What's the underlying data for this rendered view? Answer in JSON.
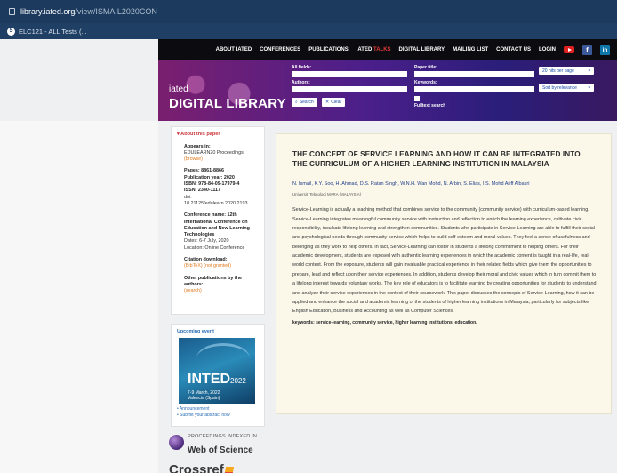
{
  "browser": {
    "url_host": "library.iated.org",
    "url_path": "/view/ISMAIL2020CON",
    "bookmark": "ELC121 - ALL Tests (..."
  },
  "topnav": {
    "items": [
      "ABOUT IATED",
      "CONFERENCES",
      "PUBLICATIONS",
      "IATED",
      "TALKS",
      "DIGITAL LIBRARY",
      "MAILING LIST",
      "CONTACT US",
      "LOGIN"
    ]
  },
  "hero": {
    "brand_small": "iated",
    "brand_big": "DIGITAL LIBRARY",
    "all_fields_label": "All fields:",
    "paper_title_label": "Paper title:",
    "authors_label": "Authors:",
    "keywords_label": "Keywords:",
    "per_page": "20 hits per page",
    "sort": "Sort by relevance",
    "search_button": "Search",
    "clear_button": "Clear",
    "fulltext_label": "Fulltext search"
  },
  "sidebar": {
    "about_header": "About this paper",
    "appears_in_label": "Appears in:",
    "appears_in_value": "EDULEARN20 Proceedings",
    "appears_in_link": "(browse)",
    "pages": "Pages: 8861-8866",
    "pub_year": "Publication year: 2020",
    "isbn": "ISBN: 978-84-09-17979-4",
    "issn": "ISSN: 2340-1117",
    "doi_label": "doi:",
    "doi_value": "10.21125/edulearn.2020.2193",
    "conf_name": "Conference name: 12th International Conference on Education and New Learning Technologies",
    "conf_dates": "Dates: 6-7 July, 2020",
    "conf_location": "Location: Online Conference",
    "citation_label": "Citation download:",
    "citation_link": "(BibTeX) (not granted)",
    "other_pubs_label": "Other publications by the authors:",
    "other_pubs_link": "(search)",
    "upcoming_header": "Upcoming event",
    "event_title": "INTED",
    "event_year": "2022",
    "event_dates": "7-9 March, 2022",
    "event_place": "Valencia (Spain)",
    "link_announcement": "• Announcement",
    "link_submit": "• Submit your abstract now",
    "wos_small": "PROCEEDINGS INDEXED IN",
    "wos_big": "Web of Science",
    "crossref": "Crossref"
  },
  "paper": {
    "title": "THE CONCEPT OF SERVICE LEARNING AND HOW IT CAN BE INTEGRATED INTO THE CURRICULUM OF A HIGHER LEARNING INSTITUTION IN MALAYSIA",
    "authors": "N. Ismail, K.Y. Soo, H. Ahmad, D.S. Ratan Singh, W.N.H. Wan Mohd, N. Arbin, S. Elias, I.S. Mohd Ariff Albakri",
    "affiliation": "Universiti Teknologi MARA (MALAYSIA)",
    "abstract": "Service-Learning is actually a teaching method that combines service to the community (community service) with curriculum-based learning. Service-Learning integrates meaningful community service with instruction and reflection to enrich the learning experience, cultivate civic responsibility, inculcate lifelong learning and strengthen communities. Students who participate in Service-Learning are able to fulfill their social and psychological needs through community service which helps to build self-esteem and moral values. They feel a sense of usefulness and belonging as they work to help others. In fact, Service-Learning can foster in students a lifelong commitment to helping others. For their academic development, students are exposed with authentic learning experiences in which the academic content is taught in a real-life, real-world context. From the exposure, students will gain invaluable practical experience in their related fields which give them the opportunities to prepare, lead and reflect upon their service experiences. In addition, students develop their moral and civic values which in turn commit them to a lifelong interest towards voluntary works. The key role of educators is to facilitate learning by creating opportunities for students to understand and analyze their service experiences in the context of their coursework. This paper discusses the concepts of Service-Learning, how it can be applied and enhance the social and academic learning of the students of higher learning institutions in Malaysia, particularly for subjects like English Education, Business and Accounting as well as Computer Sciences.",
    "keywords": "keywords: service-learning, community service, higher learning institutions, education."
  }
}
